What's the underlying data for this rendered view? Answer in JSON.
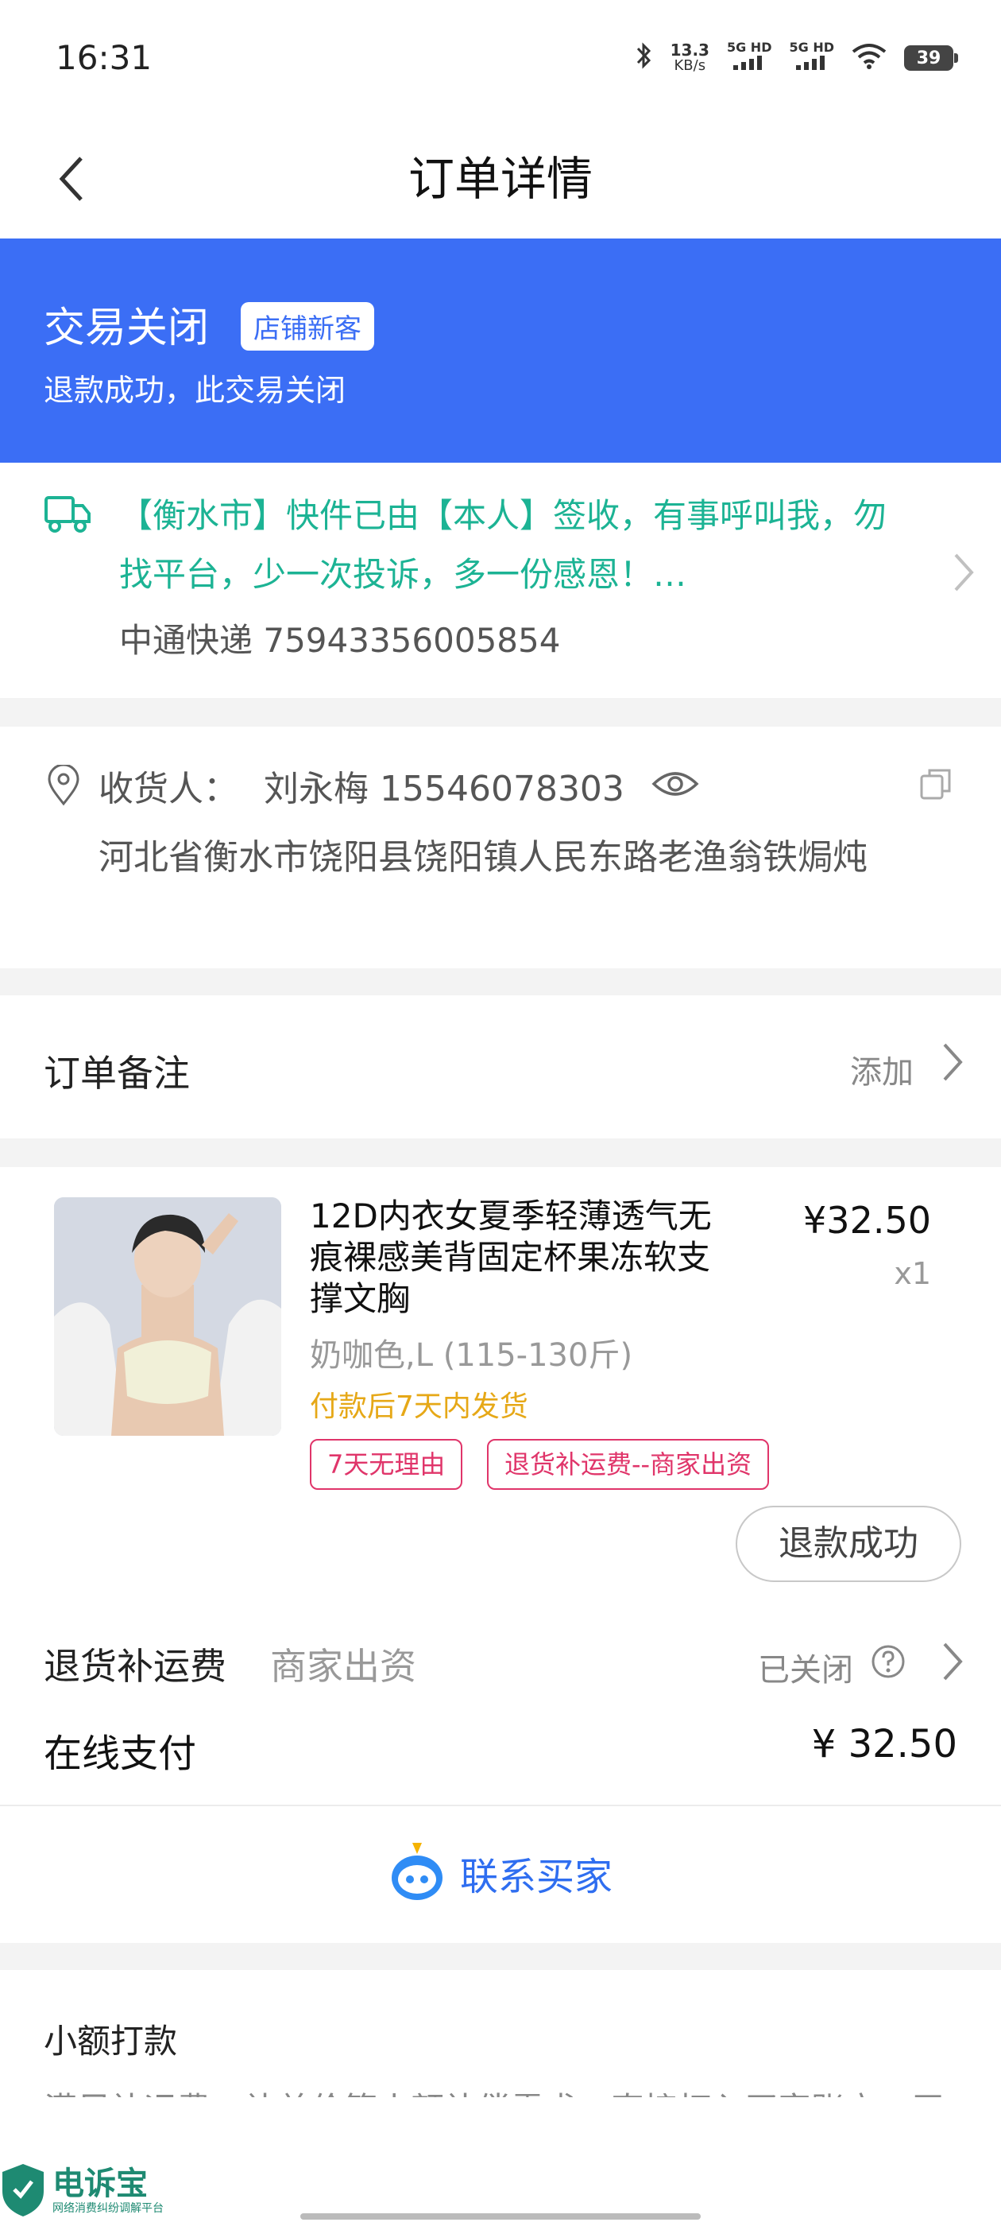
{
  "status_bar": {
    "time": "16:31",
    "net_speed_value": "13.3",
    "net_speed_unit": "KB/s",
    "sim1": "5G HD",
    "sim2": "5G HD",
    "battery": "39"
  },
  "header": {
    "title": "订单详情"
  },
  "banner": {
    "status": "交易关闭",
    "tag": "店铺新客",
    "sub": "退款成功，此交易关闭",
    "color": "#3b6ef5"
  },
  "logistics": {
    "message": "【衡水市】快件已由【本人】签收，有事呼叫我，勿找平台，少一次投诉，多一份感恩！…",
    "tracking": "中通快递 75943356005854",
    "color": "#1cb394"
  },
  "address": {
    "label": "收货人：",
    "name_phone": "刘永梅 15546078303",
    "detail": "河北省衡水市饶阳县饶阳镇人民东路老渔翁铁焗炖"
  },
  "remark": {
    "label": "订单备注",
    "action": "添加"
  },
  "product": {
    "title": "12D内衣女夏季轻薄透气无痕裸感美背固定杯果冻软支撑文胸",
    "price": "¥32.50",
    "qty": "x1",
    "sku": "奶咖色,L (115-130斤)",
    "shipping": "付款后7天内发货",
    "tags": [
      "7天无理由",
      "退货补运费--商家出资"
    ],
    "refund_button": "退款成功",
    "return_fee_label": "退货补运费",
    "return_fee_sub": "商家出资",
    "return_fee_status": "已关闭",
    "payment_label": "在线支付",
    "payment_amount": "¥ 32.50"
  },
  "contact": {
    "label": "联系买家"
  },
  "transfer": {
    "label": "小额打款",
    "cut_text": "满足补运费、补差价等小额补偿需求，直接打入买家账户，无"
  },
  "watermark": {
    "title": "电诉宝",
    "sub": "网络消费纠纷调解平台"
  }
}
